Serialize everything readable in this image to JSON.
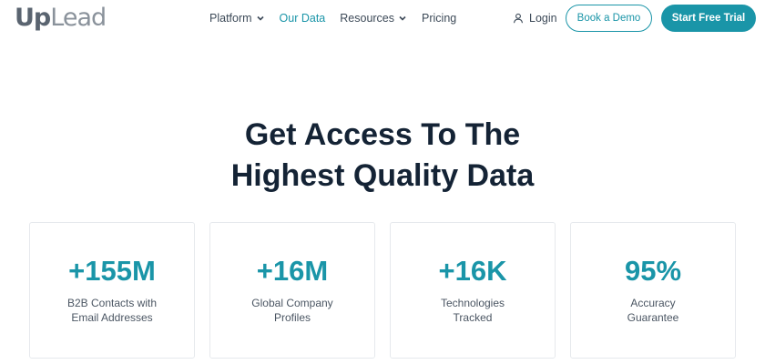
{
  "logo": {
    "part1": "Up",
    "part2": "Lead"
  },
  "nav": {
    "items": [
      {
        "label": "Platform",
        "dropdown": true,
        "active": false
      },
      {
        "label": "Our Data",
        "dropdown": false,
        "active": true
      },
      {
        "label": "Resources",
        "dropdown": true,
        "active": false
      },
      {
        "label": "Pricing",
        "dropdown": false,
        "active": false
      }
    ],
    "login_label": "Login",
    "demo_label": "Book a Demo",
    "trial_label": "Start Free Trial"
  },
  "hero": {
    "line1": "Get Access To The",
    "line2": "Highest Quality Data"
  },
  "stats": [
    {
      "value": "+155M",
      "line1": "B2B Contacts with",
      "line2": "Email Addresses"
    },
    {
      "value": "+16M",
      "line1": "Global Company",
      "line2": "Profiles"
    },
    {
      "value": "+16K",
      "line1": "Technologies",
      "line2": "Tracked"
    },
    {
      "value": "95%",
      "line1": "Accuracy",
      "line2": "Guarantee"
    }
  ],
  "colors": {
    "accent": "#1a95a8",
    "heading": "#142335",
    "text": "#3d4a58"
  },
  "icons": {
    "login": "user-icon",
    "dropdown": "chevron-down-icon"
  }
}
